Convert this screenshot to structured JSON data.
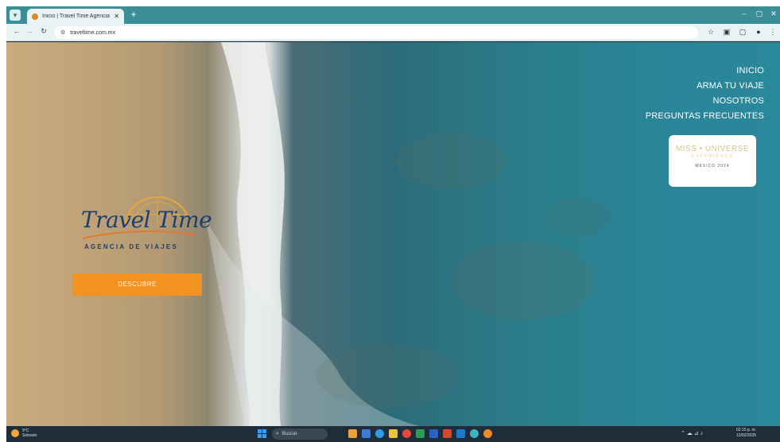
{
  "browser": {
    "tab_title": "Inicio | Travel Time Agencia de ...",
    "tab_close": "✕",
    "new_tab": "+",
    "url": "traveltime.com.mx",
    "window_controls": [
      "–",
      "▢",
      "✕"
    ]
  },
  "nav": {
    "items": [
      "INICIO",
      "ARMA TU VIAJE",
      "NOSOTROS",
      "PREGUNTAS FRECUENTES"
    ]
  },
  "badge": {
    "line1": "MISS • UNIVERSE",
    "line2": "EXPERIENCE",
    "line3": "MEXICO 2024"
  },
  "logo": {
    "script": "Travel Time",
    "subtitle": "AGENCIA DE VIAJES"
  },
  "cta": {
    "label": "DESCUBRE"
  },
  "taskbar": {
    "weather_line1": "9°C",
    "weather_line2": "Soleado",
    "search_placeholder": "Buscar",
    "time": "02:15 p. m.",
    "date": "12/02/2025"
  },
  "colors": {
    "accent": "#f29221",
    "logo_blue": "#1d3f6e",
    "tab_strip": "#3a8e97"
  }
}
